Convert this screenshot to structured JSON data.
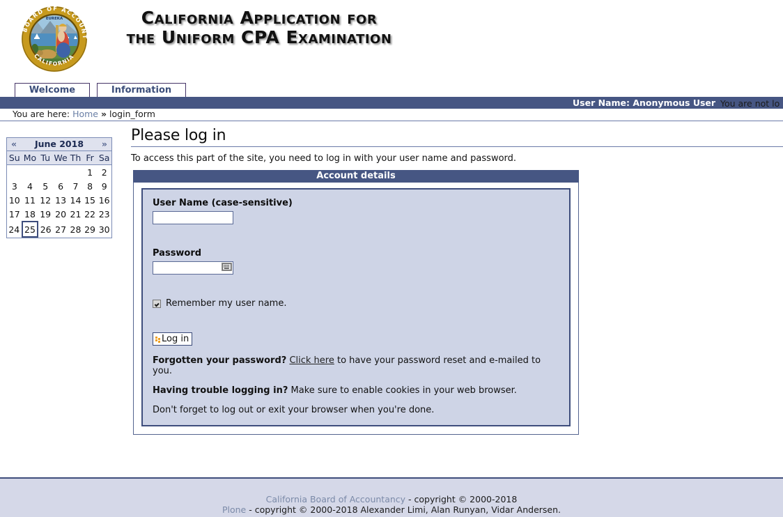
{
  "header": {
    "seal_alt": "California Board of Accountancy seal",
    "title_line1": "California Application for",
    "title_line2": "the Uniform CPA Examination"
  },
  "tabs": [
    {
      "label": "Welcome"
    },
    {
      "label": "Information"
    }
  ],
  "personalbar": {
    "user_label": "User Name: Anonymous User",
    "status": "You are not lo"
  },
  "breadcrumb": {
    "prefix": "You are here:",
    "home": "Home",
    "separator": "»",
    "current": "login_form"
  },
  "calendar": {
    "prev": "«",
    "next": "»",
    "title": "June 2018",
    "weekdays": [
      "Su",
      "Mo",
      "Tu",
      "We",
      "Th",
      "Fr",
      "Sa"
    ],
    "weeks": [
      [
        "",
        "",
        "",
        "",
        "",
        "1",
        "2"
      ],
      [
        "3",
        "4",
        "5",
        "6",
        "7",
        "8",
        "9"
      ],
      [
        "10",
        "11",
        "12",
        "13",
        "14",
        "15",
        "16"
      ],
      [
        "17",
        "18",
        "19",
        "20",
        "21",
        "22",
        "23"
      ],
      [
        "24",
        "25",
        "26",
        "27",
        "28",
        "29",
        "30"
      ]
    ],
    "today": "25"
  },
  "main": {
    "page_title": "Please log in",
    "description": "To access this part of the site, you need to log in with your user name and password.",
    "form_header": "Account details",
    "username_label": "User Name (case-sensitive)",
    "username_value": "",
    "password_label": "Password",
    "password_value": "",
    "remember_label": "Remember my user name.",
    "login_button": "Log in",
    "forgot_bold": "Forgotten your password?",
    "forgot_link": "Click here",
    "forgot_rest": "to have your password reset and e-mailed to you.",
    "trouble_bold": "Having trouble logging in?",
    "trouble_rest": "Make sure to enable cookies in your web browser.",
    "logout_note": "Don't forget to log out or exit your browser when you're done."
  },
  "footer": {
    "line1_link": "California Board of Accountancy",
    "line1_rest": "- copyright © 2000-2018",
    "line2_link": "Plone",
    "line2_rest": "- copyright © 2000-2018 Alexander Limi, Alan Runyan, Vidar Andersen."
  },
  "colors": {
    "bar_blue": "#465683",
    "border_blue": "#3e4d7c",
    "fieldset_bg": "#ced4e6",
    "footer_bg": "#d5d8e8",
    "link_gray_blue": "#6a7fa6",
    "button_icon_orange": "#f0a020"
  }
}
